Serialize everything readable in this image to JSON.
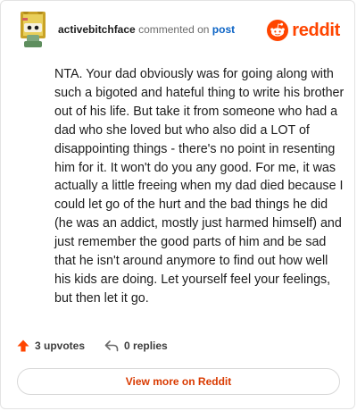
{
  "comment": {
    "username": "activebitchface",
    "action_text": "commented on",
    "post_link_text": "post",
    "body": "NTA. Your dad obviously was for going along with such a bigoted and hateful thing to write his brother out of his life. But take it from someone who had a dad who she loved but who also did a LOT of disappointing things - there's no point in resenting him for it. It won't do you any good. For me, it was actually a little freeing when my dad died because I could let go of the hurt and the bad things he did (he was an addict, mostly just harmed himself) and just remember the good parts of him and be sad that he isn't around anymore to find out how well his kids are doing. Let yourself feel your feelings, but then let it go.",
    "upvotes_text": "3 upvotes",
    "replies_text": "0 replies"
  },
  "brand": {
    "name": "reddit",
    "icon": "reddit-logo-icon",
    "color": "#ff4500"
  },
  "actions": {
    "view_more_label": "View more on Reddit"
  },
  "icons": {
    "avatar": "snoo-avatar-icon",
    "upvote": "upvote-arrow-icon",
    "reply": "reply-arrow-icon"
  },
  "colors": {
    "link": "#0b63c5",
    "upvote": "#ff4500",
    "view_more_text": "#d93a00"
  }
}
